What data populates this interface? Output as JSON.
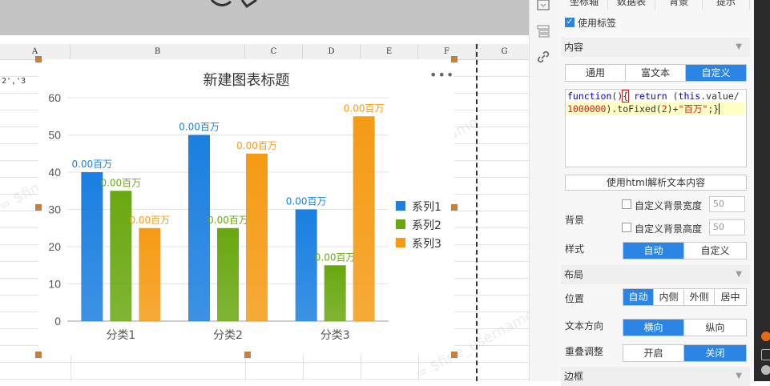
{
  "sheet": {
    "columns": [
      "A",
      "B",
      "C",
      "D",
      "E",
      "F",
      "G"
    ],
    "cell_a1": "2','3",
    "watermark": "= $fine_username"
  },
  "chart": {
    "title": "新建图表标题",
    "more_icon": "•••"
  },
  "chart_data": {
    "type": "bar",
    "categories": [
      "分类1",
      "分类2",
      "分类3"
    ],
    "series": [
      {
        "name": "系列1",
        "values": [
          40,
          50,
          30
        ],
        "color": "#1a7fe0"
      },
      {
        "name": "系列2",
        "values": [
          35,
          25,
          15
        ],
        "color": "#69a810"
      },
      {
        "name": "系列3",
        "values": [
          25,
          45,
          55
        ],
        "color": "#f59b14"
      }
    ],
    "data_label": "0.00百万",
    "ylim": [
      0,
      60
    ],
    "yticks": [
      0,
      10,
      20,
      30,
      40,
      50,
      60
    ],
    "grid": true,
    "legend": "right"
  },
  "strip": {
    "icons": [
      "panel-icon",
      "layers-icon",
      "link-icon"
    ]
  },
  "panel": {
    "tabs": [
      "坐标轴",
      "数据表",
      "背景",
      "提示"
    ],
    "use_label": "使用标签",
    "content_section": "内容",
    "content_tabs": [
      "通用",
      "富文本",
      "自定义"
    ],
    "content_selected": "自定义",
    "code_lines": {
      "l1_fn": "function",
      "l1_paren": "()",
      "l1_brace": "{",
      "l1_return": " return ",
      "l1_open": "(",
      "l1_this": "this",
      "l1_rest": ".value/",
      "l2_num": "1000000",
      "l2_mid": ").toFixed(",
      "l2_two": "2",
      "l2_plus": ")+",
      "l2_str": "\"百万\"",
      "l2_end": ";}"
    },
    "html_parse_button": "使用html解析文本内容",
    "background_label": "背景",
    "custom_bg_width": "自定义背景宽度",
    "custom_bg_height": "自定义背景高度",
    "bg_width_value": "50",
    "bg_height_value": "50",
    "style_label": "样式",
    "style_options": [
      "自动",
      "自定义"
    ],
    "layout_section": "布局",
    "position_label": "位置",
    "position_options": [
      "自动",
      "内侧",
      "外侧",
      "居中"
    ],
    "text_dir_label": "文本方向",
    "text_dir_options": [
      "横向",
      "纵向"
    ],
    "overlap_label": "重叠调整",
    "overlap_options": [
      "开启",
      "关闭"
    ],
    "border_section": "边框"
  }
}
